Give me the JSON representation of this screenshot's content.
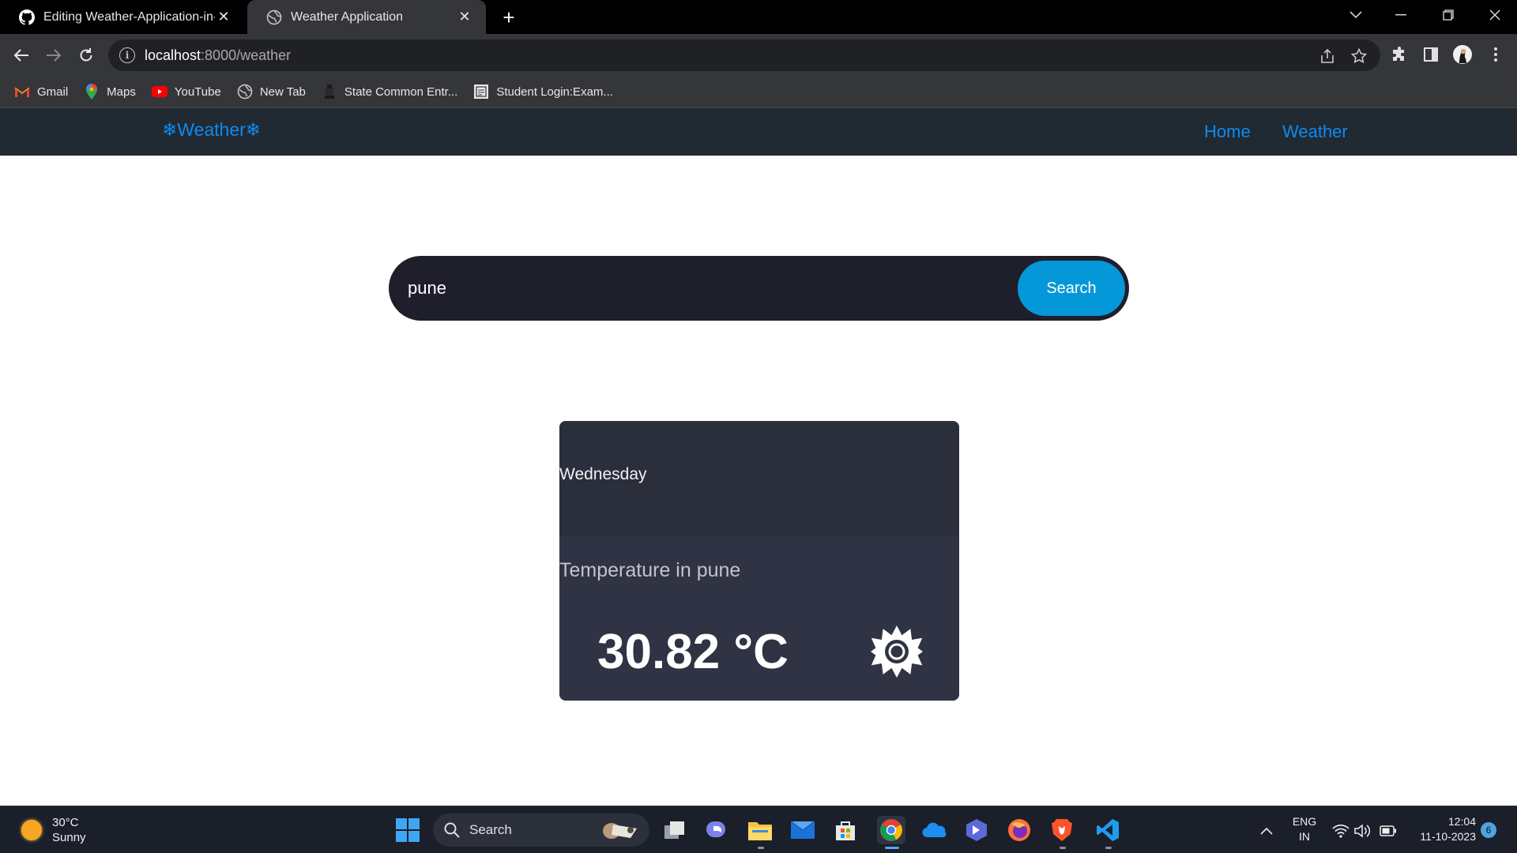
{
  "browser": {
    "tabs": [
      {
        "title": "Editing Weather-Application-in-",
        "icon": "github-icon",
        "active": false
      },
      {
        "title": "Weather Application",
        "icon": "globe-icon",
        "active": true
      }
    ],
    "new_tab_symbol": "+",
    "close_symbol": "✕",
    "url_host": "localhost",
    "url_path": ":8000/weather",
    "info_symbol": "i",
    "bookmarks": [
      {
        "label": "Gmail",
        "icon": "gmail-icon"
      },
      {
        "label": "Maps",
        "icon": "maps-icon"
      },
      {
        "label": "YouTube",
        "icon": "youtube-icon"
      },
      {
        "label": "New Tab",
        "icon": "globe-icon"
      },
      {
        "label": "State Common Entr...",
        "icon": "emblem-icon"
      },
      {
        "label": "Student Login:Exam...",
        "icon": "exam-icon"
      }
    ]
  },
  "site": {
    "brand": "❄Weather❄",
    "nav": [
      {
        "label": "Home"
      },
      {
        "label": "Weather"
      }
    ],
    "search": {
      "value": "pune",
      "button_label": "Search"
    },
    "card": {
      "day": "Wednesday",
      "label": "Temperature in pune",
      "temperature": "30.82 °C",
      "condition_icon": "sun-icon"
    },
    "colors": {
      "nav_bg": "#212933",
      "link": "#0d8bf0",
      "search_button": "#0598d8",
      "card_bg": "#303343"
    }
  },
  "taskbar": {
    "weather_temp": "30°C",
    "weather_desc": "Sunny",
    "search_label": "Search",
    "lang_1": "ENG",
    "lang_2": "IN",
    "time": "12:04",
    "date": "11-10-2023",
    "notifications": "6"
  }
}
